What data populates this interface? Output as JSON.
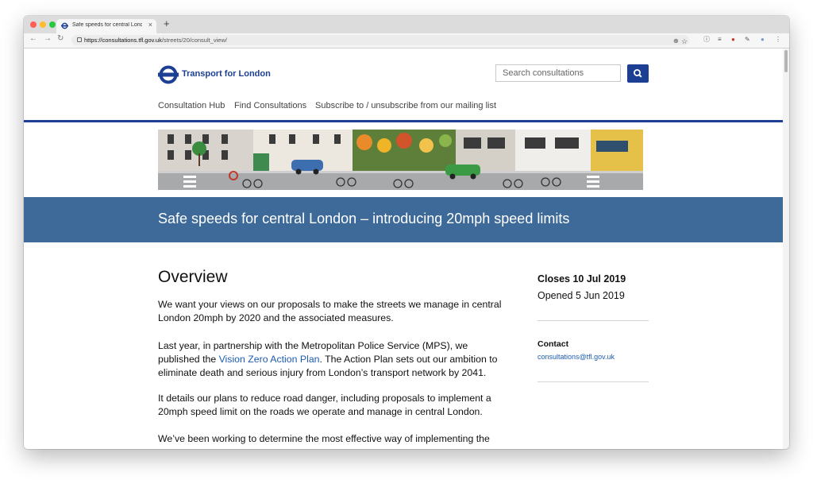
{
  "browser": {
    "tab_title": "Safe speeds for central London – introducing 20mph speed limits",
    "tab_close": "×",
    "new_tab": "+",
    "url_domain": "https://consultations.tfl.gov.uk",
    "url_path": "/streets/20/consult_view/",
    "colors": {
      "close": "#fe5f57",
      "minimize": "#febc2e",
      "maximize": "#28c840"
    }
  },
  "header": {
    "brand": "Transport for London",
    "search_placeholder": "Search consultations"
  },
  "nav": {
    "items": [
      "Consultation Hub",
      "Find Consultations",
      "Subscribe to / unsubscribe from our mailing list"
    ]
  },
  "page": {
    "title": "Safe speeds for central London – introducing 20mph speed limits",
    "overview_heading": "Overview",
    "p1": "We want your views on our proposals to make the streets we manage in central London 20mph by 2020 and the associated measures.",
    "p2_before": "Last year, in partnership with the Metropolitan Police Service (MPS), we published the ",
    "p2_link": "Vision Zero Action Plan",
    "p2_after": ". The Action Plan sets out our ambition to eliminate death and serious injury from London’s transport network by 2041.",
    "p3": "It details our plans to reduce road danger, including proposals to implement a 20mph speed limit on the roads we operate and manage in central London.",
    "p4": "We’ve been working to determine the most effective way of implementing the"
  },
  "sidebar": {
    "closes": "Closes 10 Jul 2019",
    "opened": "Opened 5 Jun 2019",
    "contact_heading": "Contact",
    "contact_email": "consultations@tfl.gov.uk"
  },
  "theme": {
    "tfl_blue": "#1c3f94",
    "title_bar": "#3d6a98",
    "link": "#1c5bb3"
  }
}
